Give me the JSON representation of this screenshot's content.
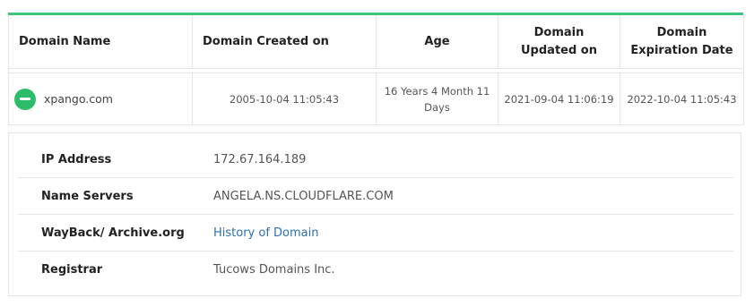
{
  "table": {
    "headers": {
      "domain_name": "Domain Name",
      "created_on": "Domain Created on",
      "age": "Age",
      "updated_on_line1": "Domain",
      "updated_on_line2": "Updated on",
      "expiration_line1": "Domain",
      "expiration_line2": "Expiration Date"
    },
    "row": {
      "domain": "xpango.com",
      "created": "2005-10-04 11:05:43",
      "age": "16 Years 4 Month 11 Days",
      "updated": "2021-09-04 11:06:19",
      "expires": "2022-10-04 11:05:43"
    }
  },
  "details": [
    {
      "label": "IP Address",
      "value": "172.67.164.189",
      "link": false
    },
    {
      "label": "Name Servers",
      "value": "ANGELA.NS.CLOUDFLARE.COM",
      "link": false
    },
    {
      "label": "WayBack/ Archive.org",
      "value": "History of Domain",
      "link": true
    },
    {
      "label": "Registrar",
      "value": "Tucows Domains Inc.",
      "link": false
    }
  ],
  "colors": {
    "accent_green": "#3ec47b",
    "toggle_green": "#2dbd6a",
    "link_blue": "#2f6fab"
  },
  "icons": {
    "row_toggle": "minus-circle-icon"
  }
}
